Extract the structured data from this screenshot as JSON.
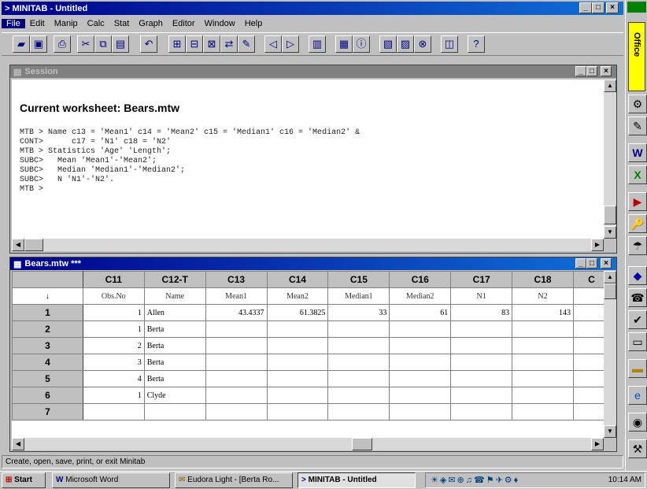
{
  "app": {
    "title": "MINITAB - Untitled",
    "title_icon": "minitab-arrow-icon"
  },
  "menu": [
    "File",
    "Edit",
    "Manip",
    "Calc",
    "Stat",
    "Graph",
    "Editor",
    "Window",
    "Help"
  ],
  "session": {
    "title": "Session",
    "heading": "Current worksheet: Bears.mtw",
    "lines": [
      "MTB > Name c13 = 'Mean1' c14 = 'Mean2' c15 = 'Median1' c16 = 'Median2' &",
      "CONT>      c17 = 'N1' c18 = 'N2'",
      "MTB > Statistics 'Age' 'Length';",
      "SUBC>   Mean 'Mean1'-'Mean2';",
      "SUBC>   Median 'Median1'-'Median2';",
      "SUBC>   N 'N1'-'N2'.",
      "MTB >"
    ]
  },
  "worksheet": {
    "title": "Bears.mtw ***",
    "columns": [
      "C11",
      "C12-T",
      "C13",
      "C14",
      "C15",
      "C16",
      "C17",
      "C18",
      "C"
    ],
    "names_row_marker": "↓",
    "column_names": [
      "Obs.No",
      "Name",
      "Mean1",
      "Mean2",
      "Median1",
      "Median2",
      "N1",
      "N2",
      ""
    ],
    "rows": [
      {
        "num": "1",
        "cells": [
          "1",
          "Allen",
          "43.4337",
          "61.3825",
          "33",
          "61",
          "83",
          "143",
          ""
        ]
      },
      {
        "num": "2",
        "cells": [
          "1",
          "Berta",
          "",
          "",
          "",
          "",
          "",
          "",
          ""
        ]
      },
      {
        "num": "3",
        "cells": [
          "2",
          "Berta",
          "",
          "",
          "",
          "",
          "",
          "",
          ""
        ]
      },
      {
        "num": "4",
        "cells": [
          "3",
          "Berta",
          "",
          "",
          "",
          "",
          "",
          "",
          ""
        ]
      },
      {
        "num": "5",
        "cells": [
          "4",
          "Berta",
          "",
          "",
          "",
          "",
          "",
          "",
          ""
        ]
      },
      {
        "num": "6",
        "cells": [
          "1",
          "Clyde",
          "",
          "",
          "",
          "",
          "",
          "",
          ""
        ]
      },
      {
        "num": "7",
        "cells": [
          "",
          "",
          "",
          "",
          "",
          "",
          "",
          "",
          ""
        ]
      }
    ]
  },
  "statusbar": {
    "text": "Create, open, save, print, or exit Minitab"
  },
  "taskbar": {
    "start_label": "Start",
    "tasks": [
      "Microsoft Word",
      "Eudora Light - [Berta Ro...",
      "MINITAB - Untitled"
    ],
    "clock": "10:14 AM"
  },
  "office_bar": {
    "label": "Office"
  },
  "colors": {
    "titlebar_start": "#00008a",
    "titlebar_end": "#1070d8",
    "office_yellow": "#ffff00"
  }
}
